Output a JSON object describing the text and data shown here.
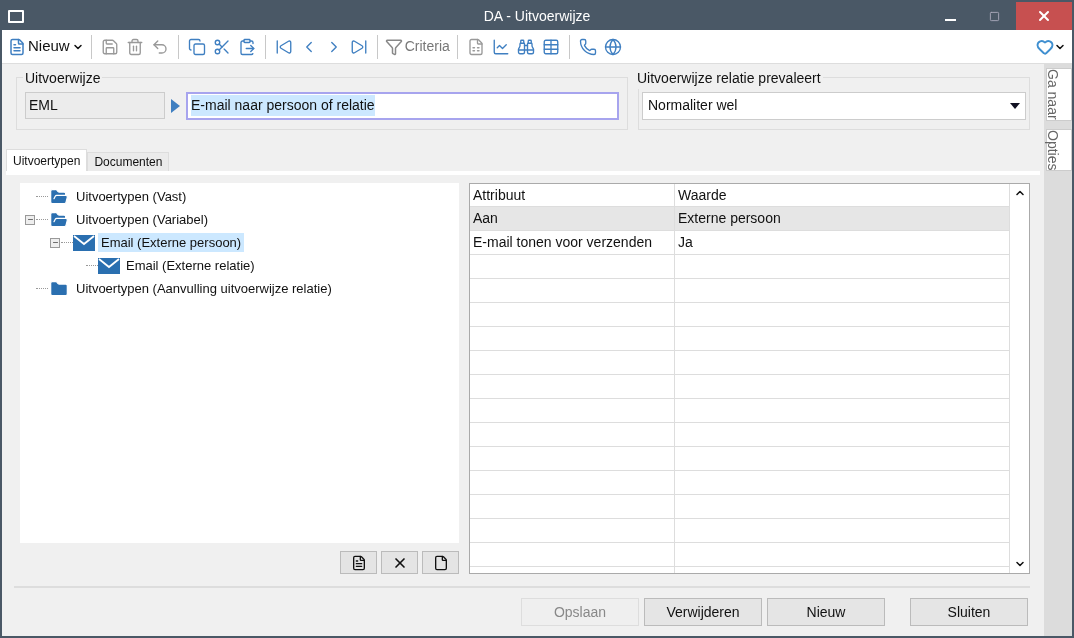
{
  "window": {
    "title": "DA - Uitvoerwijze"
  },
  "toolbar": {
    "new_label": "Nieuw",
    "criteria_label": "Criteria"
  },
  "form": {
    "code_label": "Uitvoerwijze",
    "code_value": "EML",
    "description_value": "E-mail naar persoon of relatie",
    "prevail_label": "Uitvoerwijze relatie prevaleert",
    "prevail_value": "Normaliter wel"
  },
  "side_tabs": [
    "Ga naar",
    "Opties"
  ],
  "tabs": [
    {
      "label": "Uitvoertypen",
      "selected": true
    },
    {
      "label": "Documenten",
      "selected": false
    }
  ],
  "tree": [
    {
      "label": "Uitvoertypen (Vast)",
      "kind": "folder-open",
      "selected": false
    },
    {
      "label": "Uitvoertypen (Variabel)",
      "kind": "folder-open",
      "selected": false,
      "expanded": true,
      "children": [
        {
          "label": "Email (Externe persoon)",
          "kind": "email",
          "selected": true,
          "expanded": true,
          "children": [
            {
              "label": "Email (Externe relatie)",
              "kind": "email",
              "selected": false
            }
          ]
        }
      ]
    },
    {
      "label": "Uitvoertypen (Aanvulling uitvoerwijze relatie)",
      "kind": "folder",
      "selected": false
    }
  ],
  "table": {
    "columns": [
      "Attribuut",
      "Waarde"
    ],
    "rows": [
      {
        "cells": [
          "Aan",
          "Externe persoon"
        ],
        "selected": true
      },
      {
        "cells": [
          "E-mail tonen voor verzenden",
          "Ja"
        ],
        "selected": false
      }
    ]
  },
  "buttons": [
    {
      "label": "Opslaan",
      "disabled": true
    },
    {
      "label": "Verwijderen",
      "disabled": false
    },
    {
      "label": "Nieuw",
      "disabled": false
    },
    {
      "label": "Sluiten",
      "disabled": false
    }
  ]
}
